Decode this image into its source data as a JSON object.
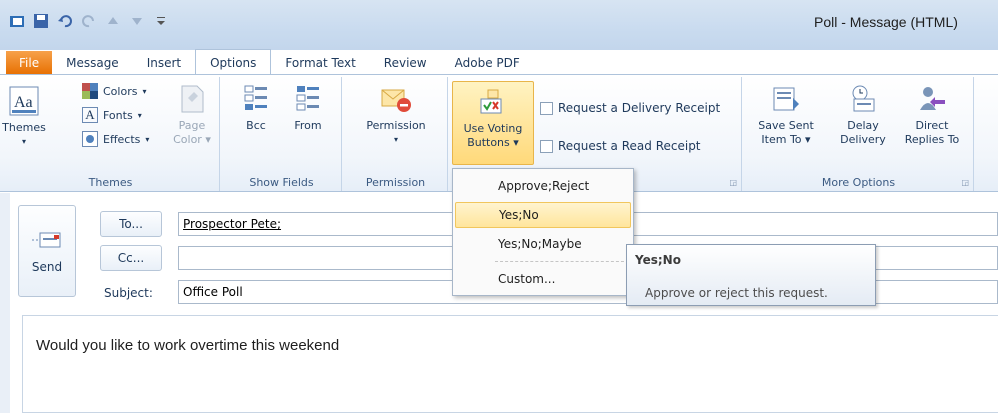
{
  "window": {
    "title": "Poll - Message (HTML)"
  },
  "quick_access": [
    "outlook-icon",
    "save-icon",
    "undo-icon",
    "redo-icon",
    "up-icon",
    "down-icon",
    "customize-icon"
  ],
  "tabs": [
    {
      "label": "File"
    },
    {
      "label": "Message"
    },
    {
      "label": "Insert"
    },
    {
      "label": "Options"
    },
    {
      "label": "Format Text"
    },
    {
      "label": "Review"
    },
    {
      "label": "Adobe PDF"
    }
  ],
  "active_tab": "Options",
  "ribbon": {
    "themes": {
      "themes_label": "Themes",
      "colors_label": "Colors",
      "fonts_label": "Fonts",
      "effects_label": "Effects",
      "page_color_line1": "Page",
      "page_color_line2": "Color",
      "group_label": "Themes"
    },
    "show_fields": {
      "bcc_label": "Bcc",
      "from_label": "From",
      "group_label": "Show Fields"
    },
    "permission": {
      "permission_label": "Permission",
      "group_label": "Permission"
    },
    "tracking": {
      "voting_line1": "Use Voting",
      "voting_line2": "Buttons",
      "delivery_receipt_label": "Request a Delivery Receipt",
      "read_receipt_label": "Request a Read Receipt"
    },
    "more_options": {
      "save_sent_line1": "Save Sent",
      "save_sent_line2": "Item To",
      "delay_line1": "Delay",
      "delay_line2": "Delivery",
      "direct_line1": "Direct",
      "direct_line2": "Replies To",
      "group_label": "More Options"
    }
  },
  "voting_menu": {
    "items": [
      {
        "label": "Approve;Reject"
      },
      {
        "label": "Yes;No"
      },
      {
        "label": "Yes;No;Maybe"
      },
      {
        "label": "Custom..."
      }
    ],
    "hovered": "Yes;No"
  },
  "tooltip": {
    "title": "Yes;No",
    "description": "Approve or reject this request."
  },
  "compose": {
    "send_label": "Send",
    "to_button": "To...",
    "cc_button": "Cc...",
    "subject_label": "Subject:",
    "to_value": "Prospector Pete;",
    "cc_value": "",
    "subject_value": "Office Poll",
    "body": "Would you like to work overtime this weekend"
  },
  "colors": {
    "file_tab": "#e76f00",
    "hover": "#ffe59c",
    "ribbon_border": "#aec3db"
  }
}
